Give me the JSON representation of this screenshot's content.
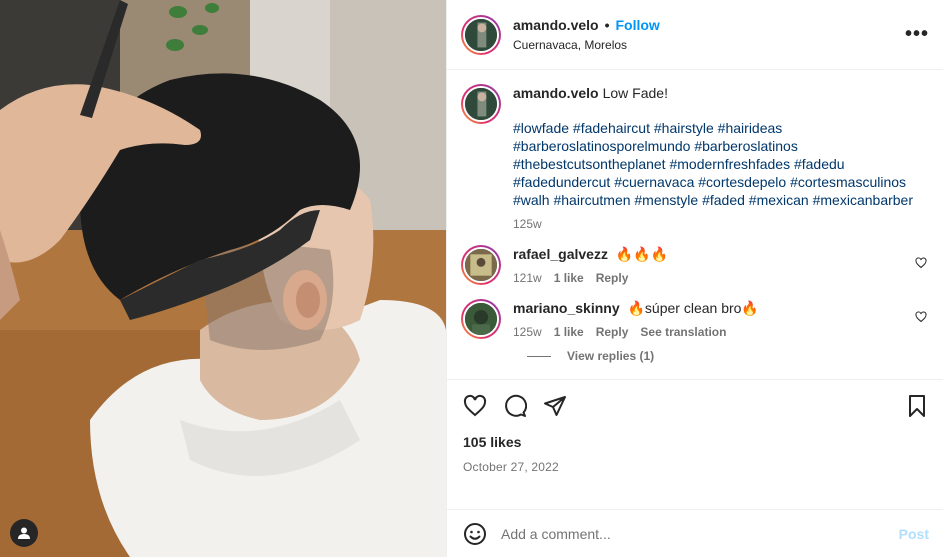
{
  "post": {
    "author": "amando.velo",
    "follow_label": "Follow",
    "separator": "•",
    "location": "Cuernavaca, Morelos",
    "more_label": "•••"
  },
  "caption": {
    "username": "amando.velo",
    "text": "Low Fade!",
    "hashtags": "#lowfade #fadehaircut #hairstyle #hairideas #barberoslatinosporelmundo #barberoslatinos #thebestcutsontheplanet #modernfreshfades #fadedu #fadedundercut #cuernavaca #cortesdepelo #cortesmasculinos #walh #haircutmen #menstyle #faded #mexican #mexicanbarber",
    "time": "125w"
  },
  "comments": [
    {
      "username": "rafael_galvezz",
      "text": "🔥🔥🔥",
      "time": "121w",
      "likes": "1 like",
      "reply": "Reply"
    },
    {
      "username": "mariano_skinny",
      "text": "🔥súper clean bro🔥",
      "time": "125w",
      "likes": "1 like",
      "reply": "Reply",
      "translate": "See translation"
    }
  ],
  "view_replies": "View replies (1)",
  "stats": {
    "likes": "105 likes",
    "date": "October 27, 2022"
  },
  "composer": {
    "placeholder": "Add a comment...",
    "post_label": "Post"
  },
  "icons": {
    "like": "heart-icon",
    "comment": "comment-icon",
    "share": "send-icon",
    "save": "bookmark-icon",
    "emoji": "emoji-icon",
    "user_tag": "user-icon"
  },
  "colors": {
    "accent": "#0095f6",
    "hashtag": "#00376b",
    "muted": "#737373",
    "post_disabled": "#b2dffc"
  }
}
